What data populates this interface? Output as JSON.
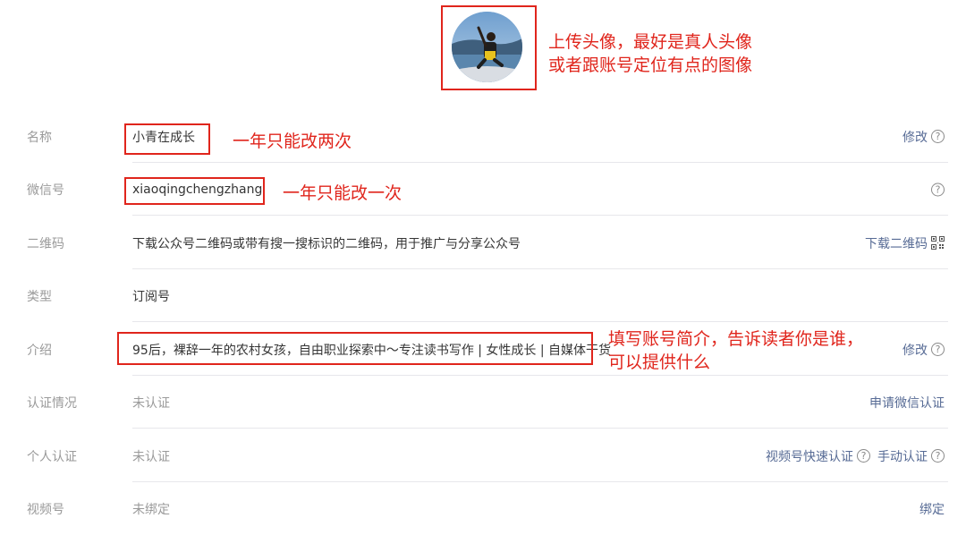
{
  "avatar": {
    "icon": "avatar-photo",
    "annotation": [
      "上传头像，最好是真人头像",
      "或者跟账号定位有点的图像"
    ]
  },
  "rows": {
    "name": {
      "label": "名称",
      "value": "小青在成长",
      "annotation": "一年只能改两次",
      "action": "修改"
    },
    "wechat_id": {
      "label": "微信号",
      "value": "xiaoqingchengzhang",
      "annotation": "一年只能改一次"
    },
    "qrcode": {
      "label": "二维码",
      "value": "下载公众号二维码或带有搜一搜标识的二维码，用于推广与分享公众号",
      "action": "下载二维码",
      "icon": "qrcode-icon"
    },
    "type": {
      "label": "类型",
      "value": "订阅号"
    },
    "intro": {
      "label": "介绍",
      "value": "95后，裸辞一年的农村女孩，自由职业探索中～专注读书写作 | 女性成长 | 自媒体干货",
      "annotation": [
        "填写账号简介，告诉读者你是谁，",
        "可以提供什么"
      ],
      "action": "修改"
    },
    "verification": {
      "label": "认证情况",
      "value": "未认证",
      "action": "申请微信认证"
    },
    "personal_verification": {
      "label": "个人认证",
      "value": "未认证",
      "action_fast": "视频号快速认证",
      "action_manual": "手动认证"
    },
    "channels": {
      "label": "视频号",
      "value": "未绑定",
      "action": "绑定"
    }
  },
  "colors": {
    "annotation_red": "#e0251c",
    "link_blue": "#576b95",
    "label_gray": "#9a9a9a",
    "divider": "#e7e7eb"
  }
}
